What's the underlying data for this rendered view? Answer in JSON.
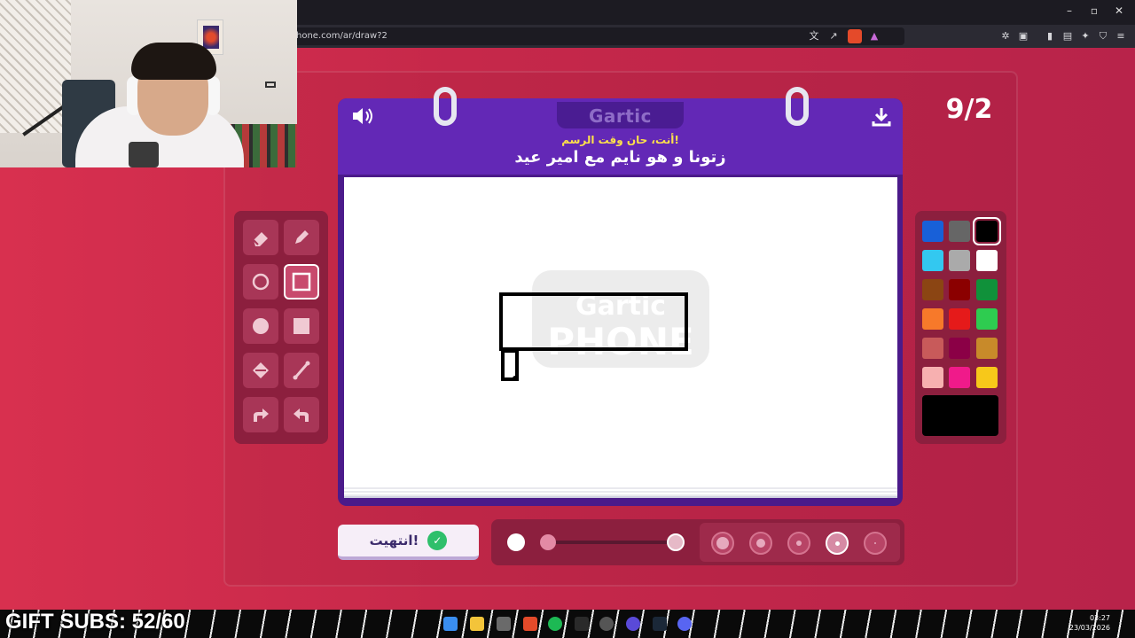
{
  "browser": {
    "url": "hone.com/ar/draw?2",
    "window_controls": [
      "minimize-icon",
      "restore-icon",
      "close-icon"
    ]
  },
  "game": {
    "logo": "Gartic",
    "prompt_subtitle": "أنت، حان وقت الرسم!",
    "prompt_title": "زتونا و هو نايم مع امير عيد",
    "round": "9/2",
    "done_button": "انتهيت!"
  },
  "tools": [
    {
      "name": "eraser-tool",
      "icon": "eraser-icon"
    },
    {
      "name": "pencil-tool",
      "icon": "pencil-icon"
    },
    {
      "name": "ellipse-outline-tool",
      "icon": "circle-outline-icon"
    },
    {
      "name": "rectangle-outline-tool",
      "icon": "square-outline-icon",
      "selected": true
    },
    {
      "name": "ellipse-filled-tool",
      "icon": "circle-filled-icon"
    },
    {
      "name": "rectangle-filled-tool",
      "icon": "square-filled-icon"
    },
    {
      "name": "fill-bucket-tool",
      "icon": "bucket-icon"
    },
    {
      "name": "line-tool",
      "icon": "line-icon"
    },
    {
      "name": "redo-tool",
      "icon": "redo-icon"
    },
    {
      "name": "undo-tool",
      "icon": "undo-icon"
    }
  ],
  "palette": {
    "colors": [
      "#1860d8",
      "#666666",
      "#000000",
      "#33c8f0",
      "#aaaaaa",
      "#ffffff",
      "#8b4513",
      "#8b0000",
      "#10913a",
      "#f7792a",
      "#e51a1a",
      "#2ecc50",
      "#c85a5a",
      "#8b0046",
      "#c88a2a",
      "#f7b0b0",
      "#f01a8a",
      "#f7c81a"
    ],
    "selected": "#000000",
    "current": "#000000"
  },
  "stroke": {
    "opacity_level": 0.0
  },
  "brush_sizes": [
    "xl",
    "l",
    "m",
    "s",
    "xs"
  ],
  "brush_selected": "s",
  "overlay": {
    "gift_subs": "GIFT SUBS: 52/60"
  },
  "taskbar": {
    "time": "03:27",
    "date": "23/03/2026"
  },
  "colors": {
    "accent_purple": "#6328b6",
    "prompt_yellow": "#ffe24a",
    "panel_dark": "#8c1f3e"
  }
}
